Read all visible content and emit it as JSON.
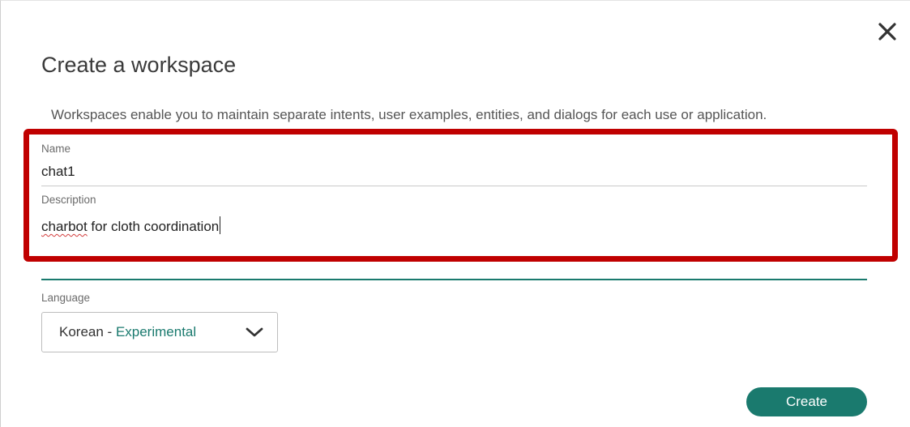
{
  "dialog": {
    "title": "Create a workspace",
    "description": "Workspaces enable you to maintain separate intents, user examples, entities, and dialogs for each use or application."
  },
  "name_field": {
    "label": "Name",
    "value": "chat1"
  },
  "description_field": {
    "label": "Description",
    "value_misspelled": "charbot",
    "value_rest": " for cloth coordination"
  },
  "language_field": {
    "label": "Language",
    "selected": "Korean",
    "separator": " - ",
    "selected_tag": "Experimental"
  },
  "actions": {
    "create_label": "Create"
  },
  "icons": {
    "close": "close-icon",
    "dropdown": "chevron-down-icon"
  },
  "colors": {
    "accent": "#1a7a6e",
    "highlight_box": "#c00000"
  }
}
